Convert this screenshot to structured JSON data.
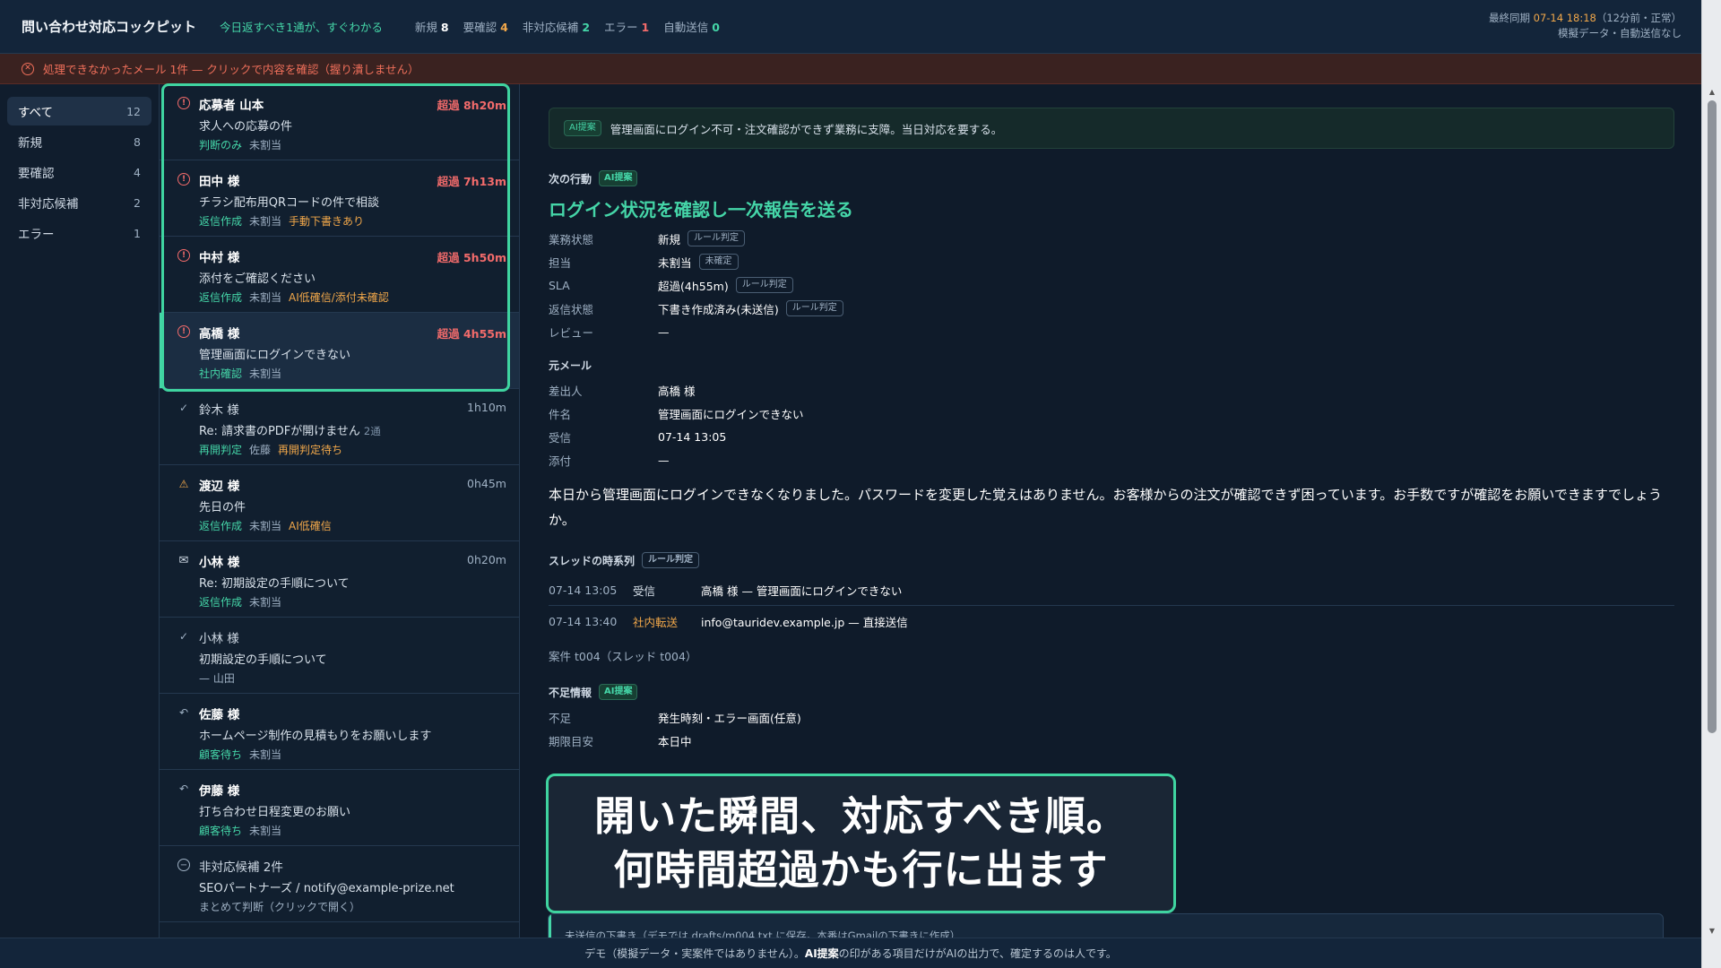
{
  "header": {
    "title": "問い合わせ対応コックピット",
    "tagline": "今日返すべき1通が、すぐわかる",
    "counts": [
      {
        "label": "新規",
        "value": "8"
      },
      {
        "label": "要確認",
        "value": "4"
      },
      {
        "label": "非対応候補",
        "value": "2"
      },
      {
        "label": "エラー",
        "value": "1"
      },
      {
        "label": "自動送信",
        "value": "0"
      }
    ],
    "sync_label": "最終同期",
    "sync_time": "07-14 18:18",
    "sync_note": "（12分前・正常）",
    "sync_sub": "模擬データ・自動送信なし"
  },
  "error_bar": {
    "text": "処理できなかったメール 1件 — クリックで内容を確認（握り潰しません）"
  },
  "sidebar": {
    "items": [
      {
        "label": "すべて",
        "count": "12"
      },
      {
        "label": "新規",
        "count": "8"
      },
      {
        "label": "要確認",
        "count": "4"
      },
      {
        "label": "非対応候補",
        "count": "2"
      },
      {
        "label": "エラー",
        "count": "1"
      }
    ]
  },
  "list": {
    "rows": [
      {
        "icon": "alert-circle-icon",
        "name": "応募者 山本",
        "time": "超過 8h20m",
        "subject": "求人への応募の件",
        "tags": [
          "判断のみ",
          "未割当"
        ]
      },
      {
        "icon": "alert-circle-icon",
        "name": "田中 様",
        "time": "超過 7h13m",
        "subject": "チラシ配布用QRコードの件で相談",
        "tags": [
          "返信作成",
          "未割当",
          "手動下書きあり"
        ]
      },
      {
        "icon": "alert-circle-icon",
        "name": "中村 様",
        "time": "超過 5h50m",
        "subject": "添付をご確認ください",
        "tags": [
          "返信作成",
          "未割当",
          "AI低確信/添付未確認"
        ]
      },
      {
        "icon": "alert-circle-icon",
        "name": "高橋 様",
        "time": "超過 4h55m",
        "subject": "管理画面にログインできない",
        "tags": [
          "社内確認",
          "未割当"
        ]
      },
      {
        "icon": "check-icon",
        "name": "鈴木 様",
        "time": "1h10m",
        "subject": "Re: 請求書のPDFが開けません",
        "count": "2通",
        "tags": [
          "再開判定",
          "佐藤",
          "再開判定待ち"
        ]
      },
      {
        "icon": "warning-icon",
        "name": "渡辺 様",
        "time": "0h45m",
        "subject": "先日の件",
        "tags": [
          "返信作成",
          "未割当",
          "AI低確信"
        ]
      },
      {
        "icon": "mail-icon",
        "name": "小林 様",
        "time": "0h20m",
        "subject": "Re: 初期設定の手順について",
        "tags": [
          "返信作成",
          "未割当"
        ]
      },
      {
        "icon": "check-icon",
        "name": "小林 様",
        "time": "",
        "subject": "初期設定の手順について",
        "tags": [
          "— 山田"
        ]
      },
      {
        "icon": "reply-icon",
        "name": "佐藤 様",
        "time": "",
        "subject": "ホームページ制作の見積もりをお願いします",
        "tags": [
          "顧客待ち",
          "未割当"
        ]
      },
      {
        "icon": "reply-icon",
        "name": "伊藤 様",
        "time": "",
        "subject": "打ち合わせ日程変更のお願い",
        "tags": [
          "顧客待ち",
          "未割当"
        ]
      },
      {
        "icon": "minus-circle-icon",
        "name": "非対応候補 2件",
        "time": "",
        "subject": "SEOパートナーズ / notify@example-prize.net",
        "tags": [
          "まとめて判断（クリックで開く）"
        ]
      }
    ]
  },
  "detail": {
    "ai_tag": "AI提案",
    "summary": "管理画面にログイン不可・注文確認ができず業務に支障。当日対応を要する。",
    "next_action_label": "次の行動",
    "next_action": "ログイン状況を確認し一次報告を送る",
    "status_fields": [
      {
        "key": "業務状態",
        "value": "新規",
        "tag": "ルール判定"
      },
      {
        "key": "担当",
        "value": "未割当",
        "tag": "未確定"
      },
      {
        "key": "SLA",
        "value": "超過(4h55m)",
        "tag": "ルール判定"
      },
      {
        "key": "返信状態",
        "value": "下書き作成済み(未送信)",
        "tag": "ルール判定"
      },
      {
        "key": "レビュー",
        "value": "—",
        "tag": ""
      }
    ],
    "original_label": "元メール",
    "original_fields": [
      {
        "key": "差出人",
        "value": "高橋 様"
      },
      {
        "key": "件名",
        "value": "管理画面にログインできない"
      },
      {
        "key": "受信",
        "value": "07-14 13:05"
      },
      {
        "key": "添付",
        "value": "—"
      }
    ],
    "body": "本日から管理画面にログインできなくなりました。パスワードを変更した覚えはありません。お客様からの注文が確認できず困っています。お手数ですが確認をお願いできますでしょうか。",
    "timeline_label": "スレッドの時系列",
    "timeline_tag": "ルール判定",
    "timeline": [
      {
        "date": "07-14 13:05",
        "type": "受信",
        "text": "高橋 様 — 管理画面にログインできない"
      },
      {
        "date": "07-14 13:40",
        "type": "社内転送",
        "text": "info@tauridev.example.jp — 直接送信"
      }
    ],
    "case_text": "案件 t004（スレッド t004）",
    "missing_label": "不足情報",
    "missing_fields": [
      {
        "key": "不足",
        "value": "発生時刻・エラー画面(任意)"
      },
      {
        "key": "期限目安",
        "value": "本日中"
      }
    ],
    "draft_note": "未送信の下書き（デモでは drafts/m004.txt に保存。本番はGmailの下書きに作成）"
  },
  "callout": {
    "line1": "開いた瞬間、対応すべき順。",
    "line2": "何時間超過かも行に出ます"
  },
  "footer": {
    "prefix": "デモ（模擬データ・実案件ではありません）。",
    "ai_mark": "AI提案",
    "suffix": "の印がある項目だけがAIの出力で、確定するのは人です。"
  },
  "colors": {
    "accent": "#45d6a8",
    "overdue": "#f26b6b",
    "warning": "#f2a84a",
    "background": "#0f1b2a"
  }
}
